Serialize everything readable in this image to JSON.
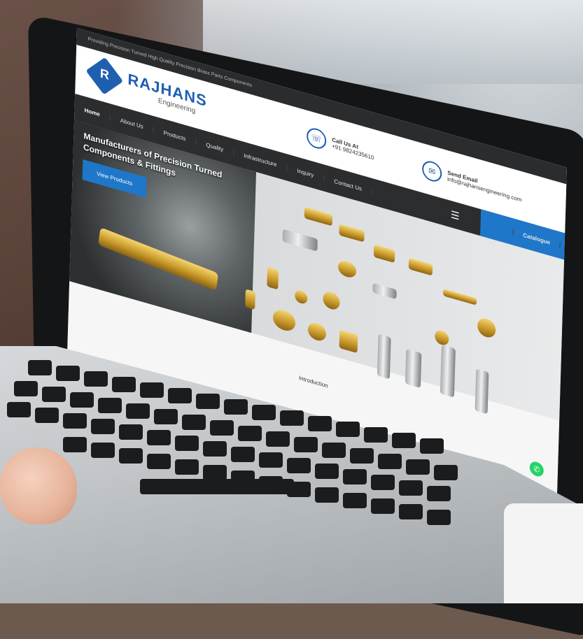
{
  "website": {
    "topbar_text": "Providing Precision Turned High Quality Precision Brass Parts Components",
    "brand": "RAJHANS",
    "brand_sub": "Engineering",
    "call_label": "Call Us At",
    "call_value": "+91 9824235610",
    "email_label": "Send Email",
    "email_value": "info@rajhansengineering.com",
    "nav": [
      "Home",
      "About Us",
      "Products",
      "Quality",
      "Infrastructure",
      "Inquiry",
      "Contact Us"
    ],
    "catalogue_label": "Catalogue",
    "hero_title": "Manufacturers of Precision Turned Components & Fittings",
    "view_products_label": "View Products",
    "intro_label": "Introduction"
  },
  "colors": {
    "accent": "#1f77c9",
    "brand": "#1f5fb0",
    "nav_bg": "#2b2d2f"
  },
  "icons": [
    "logo-mark",
    "phone-icon",
    "email-icon",
    "menu-icon",
    "whatsapp-icon",
    "user-icon"
  ]
}
